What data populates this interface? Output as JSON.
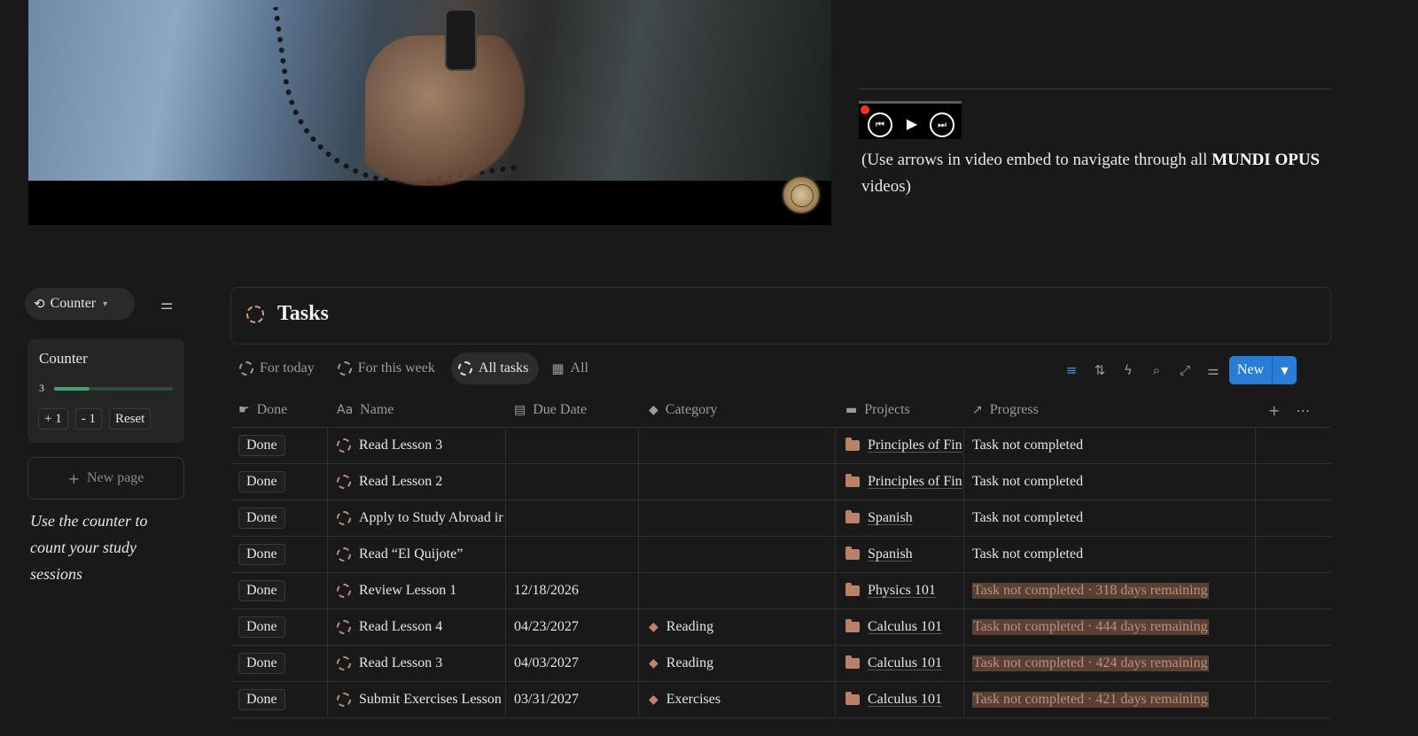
{
  "embed": {
    "note_prefix": "(Use arrows in video embed to navigate through all ",
    "note_bold": "MUNDI OPUS",
    "note_suffix": " videos)"
  },
  "player": {
    "prev_icon": "⏮",
    "play_icon": "▶",
    "next_icon": "⏭"
  },
  "counter": {
    "chip_label": "Counter",
    "card_title": "Counter",
    "value": "3",
    "progress_fraction": 0.3,
    "buttons": [
      "+ 1",
      "- 1",
      "Reset"
    ]
  },
  "sidebar": {
    "new_page": "New page",
    "hint": "Use the counter to count your study sessions"
  },
  "tasks": {
    "title": "Tasks",
    "views": [
      "For today",
      "For this week",
      "All tasks",
      "All"
    ],
    "new_button": "New",
    "columns": [
      "Done",
      "Name",
      "Due Date",
      "Category",
      "Projects",
      "Progress"
    ],
    "rows": [
      {
        "done": "Done",
        "name": "Read Lesson 3",
        "due": "",
        "category": "",
        "project": "Principles of Fin",
        "progress": "Task not completed",
        "highlight": false
      },
      {
        "done": "Done",
        "name": "Read Lesson 2",
        "due": "",
        "category": "",
        "project": "Principles of Fin",
        "progress": "Task not completed",
        "highlight": false
      },
      {
        "done": "Done",
        "name": "Apply to Study Abroad ir",
        "due": "",
        "category": "",
        "project": "Spanish",
        "progress": "Task not completed",
        "highlight": false
      },
      {
        "done": "Done",
        "name": "Read “El Quijote”",
        "due": "",
        "category": "",
        "project": "Spanish",
        "progress": "Task not completed",
        "highlight": false
      },
      {
        "done": "Done",
        "name": "Review Lesson 1",
        "due": "12/18/2026",
        "category": "",
        "project": "Physics 101",
        "progress": "Task not completed · 318 days remaining",
        "highlight": true
      },
      {
        "done": "Done",
        "name": "Read Lesson 4",
        "due": "04/23/2027",
        "category": "Reading",
        "project": "Calculus 101",
        "progress": "Task not completed · 444 days remaining",
        "highlight": true
      },
      {
        "done": "Done",
        "name": "Read Lesson 3",
        "due": "04/03/2027",
        "category": "Reading",
        "project": "Calculus 101",
        "progress": "Task not completed · 424 days remaining",
        "highlight": true
      },
      {
        "done": "Done",
        "name": "Submit Exercises Lesson",
        "due": "03/31/2027",
        "category": "Exercises",
        "project": "Calculus 101",
        "progress": "Task not completed · 421 days remaining",
        "highlight": true
      }
    ]
  },
  "colors": {
    "background": "#191919",
    "accent_blue": "#2a7dd6",
    "progress_highlight": "#5a3f33",
    "counter_bar": "#3ca56b"
  }
}
